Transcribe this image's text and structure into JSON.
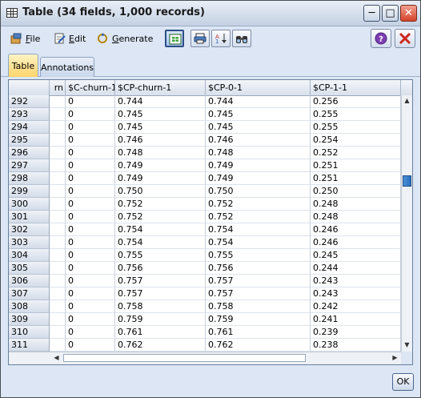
{
  "window": {
    "title": "Table (34 fields, 1,000 records)"
  },
  "menu": {
    "file": {
      "label_u": "F",
      "label_rest": "ile"
    },
    "edit": {
      "label_u": "E",
      "label_rest": "dit"
    },
    "generate": {
      "label_u": "G",
      "label_rest": "enerate"
    }
  },
  "tabs": [
    {
      "label": "Table",
      "active": true
    },
    {
      "label": "Annotations",
      "active": false
    }
  ],
  "table": {
    "columns": [
      "rn",
      "$C-churn-1",
      "$CP-churn-1",
      "$CP-0-1",
      "$CP-1-1"
    ],
    "rows": [
      {
        "n": "292",
        "c": [
          "0",
          "0.744",
          "0.744",
          "0.256"
        ]
      },
      {
        "n": "293",
        "c": [
          "0",
          "0.745",
          "0.745",
          "0.255"
        ]
      },
      {
        "n": "294",
        "c": [
          "0",
          "0.745",
          "0.745",
          "0.255"
        ]
      },
      {
        "n": "295",
        "c": [
          "0",
          "0.746",
          "0.746",
          "0.254"
        ]
      },
      {
        "n": "296",
        "c": [
          "0",
          "0.748",
          "0.748",
          "0.252"
        ]
      },
      {
        "n": "297",
        "c": [
          "0",
          "0.749",
          "0.749",
          "0.251"
        ]
      },
      {
        "n": "298",
        "c": [
          "0",
          "0.749",
          "0.749",
          "0.251"
        ]
      },
      {
        "n": "299",
        "c": [
          "0",
          "0.750",
          "0.750",
          "0.250"
        ]
      },
      {
        "n": "300",
        "c": [
          "0",
          "0.752",
          "0.752",
          "0.248"
        ]
      },
      {
        "n": "301",
        "c": [
          "0",
          "0.752",
          "0.752",
          "0.248"
        ]
      },
      {
        "n": "302",
        "c": [
          "0",
          "0.754",
          "0.754",
          "0.246"
        ]
      },
      {
        "n": "303",
        "c": [
          "0",
          "0.754",
          "0.754",
          "0.246"
        ]
      },
      {
        "n": "304",
        "c": [
          "0",
          "0.755",
          "0.755",
          "0.245"
        ]
      },
      {
        "n": "305",
        "c": [
          "0",
          "0.756",
          "0.756",
          "0.244"
        ]
      },
      {
        "n": "306",
        "c": [
          "0",
          "0.757",
          "0.757",
          "0.243"
        ]
      },
      {
        "n": "307",
        "c": [
          "0",
          "0.757",
          "0.757",
          "0.243"
        ]
      },
      {
        "n": "308",
        "c": [
          "0",
          "0.758",
          "0.758",
          "0.242"
        ]
      },
      {
        "n": "309",
        "c": [
          "0",
          "0.759",
          "0.759",
          "0.241"
        ]
      },
      {
        "n": "310",
        "c": [
          "0",
          "0.761",
          "0.761",
          "0.239"
        ]
      },
      {
        "n": "311",
        "c": [
          "0",
          "0.762",
          "0.762",
          "0.238"
        ]
      }
    ]
  },
  "buttons": {
    "ok": "OK"
  },
  "icons": [
    "table-icon",
    "file-icon",
    "edit-icon",
    "generate-icon",
    "table-view-icon",
    "print-icon",
    "sort-icon",
    "find-icon",
    "help-icon",
    "close-icon",
    "minimize-icon",
    "maximize-icon"
  ]
}
